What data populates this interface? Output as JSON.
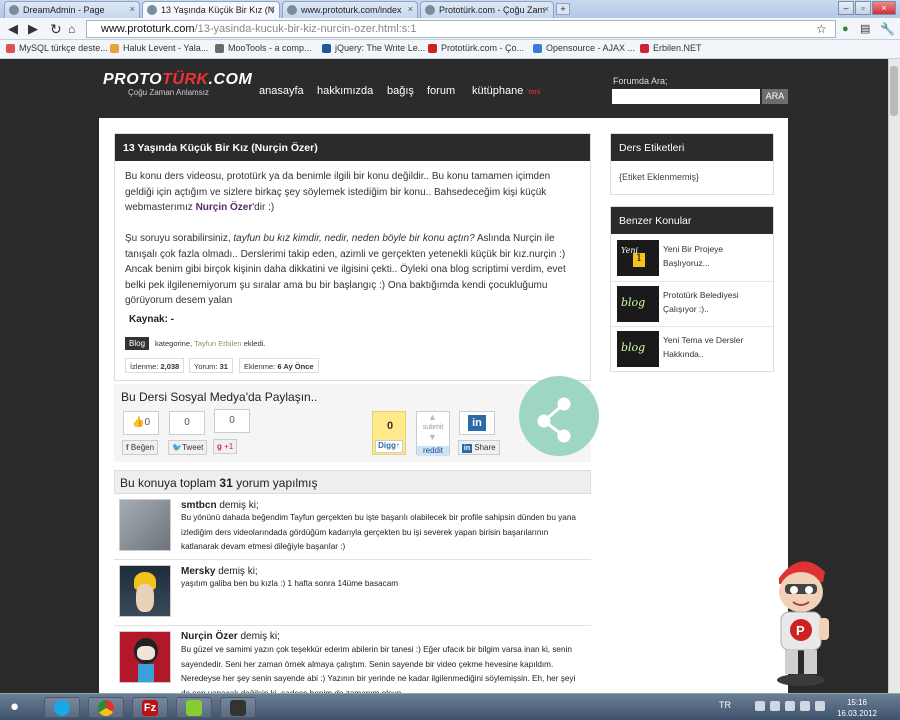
{
  "browser": {
    "tabs": [
      {
        "label": "DreamAdmin - Page",
        "active": false
      },
      {
        "label": "13 Yaşında Küçük Bir Kız (N",
        "active": true
      },
      {
        "label": "www.prototurk.com/index",
        "active": false
      },
      {
        "label": "Prototürk.com - Çoğu Zam",
        "active": false
      }
    ],
    "url_domain": "www.prototurk.com",
    "url_path": "/13-yasinda-kucuk-bir-kiz-nurcin-ozer.html:s:1",
    "bookmarks": [
      {
        "label": "MySQL türkçe deste...",
        "color": "#d9534f"
      },
      {
        "label": "Haluk Levent - Yala...",
        "color": "#e8a23c"
      },
      {
        "label": "MooTools - a comp...",
        "color": "#6b6b6b"
      },
      {
        "label": "jQuery: The Write Le...",
        "color": "#1b5a9b"
      },
      {
        "label": "Prototürk.com - Ço...",
        "color": "#c22"
      },
      {
        "label": "Opensource - AJAX ...",
        "color": "#3a7bd5"
      },
      {
        "label": "Erbilen.NET",
        "color": "#c23"
      }
    ]
  },
  "site": {
    "logo_a": "PROTO",
    "logo_b": "TÜRK",
    "logo_c": ".COM",
    "tagline": "Çoğu Zaman Anlamsız",
    "menu": [
      "anasayfa",
      "hakkımızda",
      "bağış",
      "forum",
      "kütüphane"
    ],
    "menu_badge": "Yeni",
    "search_label": "Forumda Ara;",
    "search_button": "ARA"
  },
  "article": {
    "title": "13 Yaşında Küçük Bir Kız (Nurçin Özer)",
    "p1_a": "Bu konu ders videosu, prototürk ya da benimle ilgili bir konu değildir.. Bu konu tamamen içimden geldiği için açtığım ve sizlere birkaç şey söylemek istediğim bir konu.. Bahsedeceğim kişi küçük webmasterımız ",
    "p1_name": "Nurçin Özer",
    "p1_b": "'dir :)",
    "p2_a": "Şu soruyu sorabilirsiniz, ",
    "p2_italic": "tayfun bu kız kimdir, nedir, neden böyle bir konu açtın?",
    "p2_b": " Aslında Nurçin ile tanışalı çok fazla olmadı.. Derslerimi takip eden, azimli ve gerçekten yetenekli küçük bir kız.nurçin :) Ancak benim gibi birçok kişinin daha dikkatini ve ilgisini çekti.. Öyleki ona blog scriptimi verdim, evet belki pek ilgilenemiyorum şu sıralar ama bu bir başlangıç :) Ona baktığımda kendi çocukluğumu görüyorum desem yalan",
    "source": "Kaynak: -",
    "category_tag": "Blog",
    "category_text": "kategorine,",
    "author": "Tayfun Erbilen",
    "added": "ekledi.",
    "stats": [
      {
        "label": "İzlenme:",
        "value": "2,038"
      },
      {
        "label": "Yorum:",
        "value": "31"
      },
      {
        "label": "Eklenme:",
        "value": "6 Ay Önce"
      }
    ]
  },
  "social": {
    "title": "Bu Dersi Sosyal Medya'da Paylaşın..",
    "fb_count": "0",
    "fb_label": "Beğen",
    "tw_count": "0",
    "tw_label": "Tweet",
    "gp_count": "0",
    "gp_label": "+1",
    "digg_count": "0",
    "digg_label": "Digg",
    "submit_label": "submit",
    "reddit_label": "reddit",
    "li_label": "Share"
  },
  "comments": {
    "heading_a": "Bu konuya toplam ",
    "count": "31",
    "heading_b": " yorum yapılmış",
    "suffix": "demiş ki;",
    "items": [
      {
        "name": "smtbcn",
        "text": "Bu yönünü dahada beğendim Tayfun gerçekten bu işte başarılı olabilecek bir profile sahipsin dünden bu yana izlediğim ders videolarındada gördüğüm kadarıyla gerçekten bu işi severek yapan birisin başarılarının katlanarak devam etmesi dileğiyle başarılar :)",
        "avatar_color": "#8a8f95"
      },
      {
        "name": "Mersky",
        "text": "yaşıtım galiba ben bu kızla :) 1 hafta sonra 14üme basacam",
        "avatar_color": "#2a3a4a"
      },
      {
        "name": "Nurçin Özer",
        "text": "Bu güzel ve samimi yazın çok teşekkür ederim abilerin bir tanesi :) Eğer ufacık bir bilgim varsa inan ki, senin sayendedir. Seni her zaman örnek almaya çalıştım. Senin sayende bir video çekme hevesine kapıldım. Neredeyse her şey senin sayende abi :) Yazının bir yerinde ne kadar ilgilenmediğini söylemişsin. Eh, her şeyi de sen yapacak değilsin ki, sadece benim de zamanım olsun",
        "avatar_color": "#b3172a"
      }
    ]
  },
  "sidebar": {
    "tags_title": "Ders Etiketleri",
    "tags_empty": "{Etiket Eklenmemiş}",
    "related_title": "Benzer Konular",
    "related": [
      {
        "title": "Yeni Bir Projeye Başlıyoruz...",
        "thumb": "Yeni"
      },
      {
        "title": "Prototürk Belediyesi Çalışıyor :)..",
        "thumb": "blog"
      },
      {
        "title": "Yeni Tema ve Dersler Hakkında..",
        "thumb": "blog"
      }
    ]
  },
  "taskbar": {
    "lang": "TR",
    "time": "15:16",
    "date": "16.03.2012"
  }
}
